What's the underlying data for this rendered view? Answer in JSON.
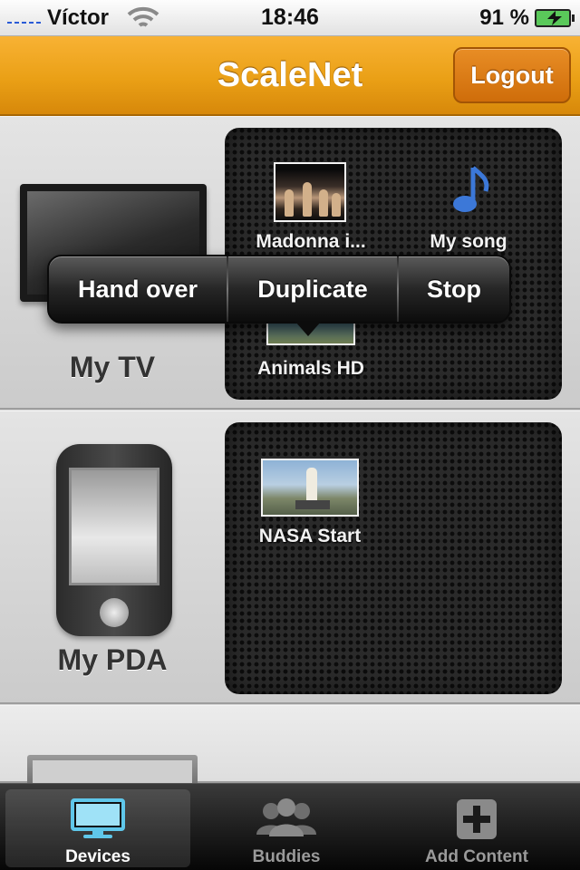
{
  "status_bar": {
    "carrier": "Víctor",
    "time": "18:46",
    "battery": "91 %"
  },
  "nav": {
    "title": "ScaleNet",
    "logout_label": "Logout"
  },
  "devices": [
    {
      "name": "My TV",
      "items": [
        {
          "label": "Madonna i...",
          "type": "video"
        },
        {
          "label": "My song",
          "type": "audio"
        },
        {
          "label": "Animals HD",
          "type": "video"
        }
      ]
    },
    {
      "name": "My PDA",
      "items": [
        {
          "label": "NASA Start",
          "type": "video"
        }
      ]
    }
  ],
  "context_menu": {
    "items": [
      "Hand over",
      "Duplicate",
      "Stop"
    ]
  },
  "tabbar": {
    "tabs": [
      {
        "label": "Devices",
        "icon": "monitor-icon",
        "active": true
      },
      {
        "label": "Buddies",
        "icon": "people-icon",
        "active": false
      },
      {
        "label": "Add Content",
        "icon": "plus-icon",
        "active": false
      }
    ]
  },
  "colors": {
    "navbar_orange": "#eaa016",
    "logout_orange": "#d9750f",
    "tab_active": "#ffffff",
    "tab_inactive": "#9a9a9a"
  }
}
